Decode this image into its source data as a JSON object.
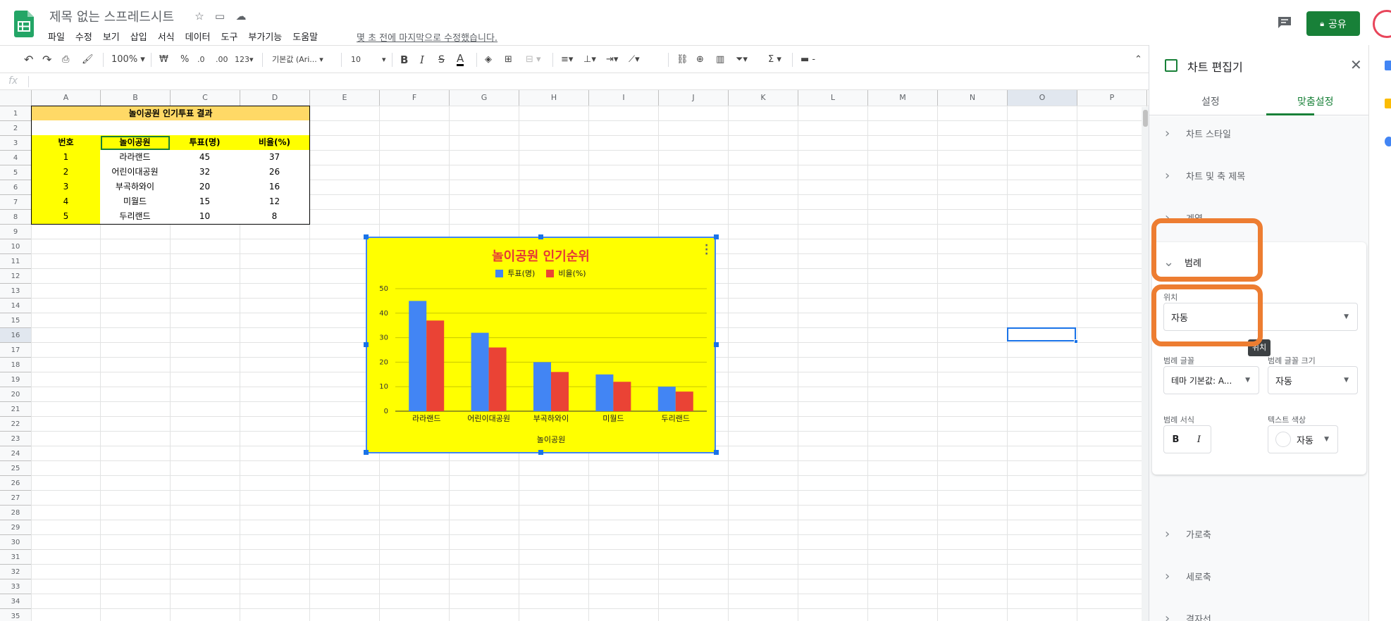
{
  "header": {
    "doc_title": "제목 없는 스프레드시트",
    "menus": [
      "파일",
      "수정",
      "보기",
      "삽입",
      "서식",
      "데이터",
      "도구",
      "부가기능",
      "도움말"
    ],
    "last_edit": "몇 초 전에 마지막으로 수정했습니다.",
    "share_label": "공유"
  },
  "toolbar": {
    "zoom": "100%",
    "currency": "₩",
    "percent": "%",
    "dec_decrease": ".0",
    "dec_increase": ".00",
    "format_more": "123",
    "font": "기본값 (Ari...",
    "font_size": "10",
    "bold": "B",
    "italic": "I",
    "strike": "S",
    "text_color": "A",
    "sum": "Σ"
  },
  "formula_bar": {
    "fx": "fx"
  },
  "grid": {
    "columns": [
      "A",
      "B",
      "C",
      "D",
      "E",
      "F",
      "G",
      "H",
      "I",
      "J",
      "K",
      "L",
      "M",
      "N",
      "O",
      "P"
    ],
    "rows": [
      "1",
      "2",
      "3",
      "4",
      "5",
      "6",
      "7",
      "8",
      "9",
      "10",
      "11",
      "12",
      "13",
      "14",
      "15",
      "16",
      "17",
      "18",
      "19",
      "20",
      "21",
      "22",
      "23",
      "24",
      "25",
      "26",
      "27",
      "28",
      "29",
      "30",
      "31",
      "32",
      "33",
      "34",
      "35"
    ]
  },
  "table": {
    "title": "놀이공원 인기투표 결과",
    "headers": [
      "번호",
      "놀이공원",
      "투표(명)",
      "비율(%)"
    ],
    "rows": [
      [
        "1",
        "라라랜드",
        "45",
        "37"
      ],
      [
        "2",
        "어린이대공원",
        "32",
        "26"
      ],
      [
        "3",
        "부곡하와이",
        "20",
        "16"
      ],
      [
        "4",
        "미월드",
        "15",
        "12"
      ],
      [
        "5",
        "두리랜드",
        "10",
        "8"
      ]
    ]
  },
  "chart_data": {
    "type": "bar",
    "title": "놀이공원 인기순위",
    "xlabel": "놀이공원",
    "ylabel": "",
    "categories": [
      "라라랜드",
      "어린이대공원",
      "부곡하와이",
      "미월드",
      "두리랜드"
    ],
    "series": [
      {
        "name": "투표(명)",
        "values": [
          45,
          32,
          20,
          15,
          10
        ],
        "color": "#4285f4"
      },
      {
        "name": "비율(%)",
        "values": [
          37,
          26,
          16,
          12,
          8
        ],
        "color": "#ea4335"
      }
    ],
    "ylim": [
      0,
      50
    ],
    "yticks": [
      "0",
      "10",
      "20",
      "30",
      "40",
      "50"
    ],
    "legend_position": "top",
    "grid": true,
    "background": "#ffff00",
    "title_color": "#e53935"
  },
  "side_panel": {
    "title": "차트 편집기",
    "tabs": [
      "설정",
      "맞춤설정"
    ],
    "sections_top": [
      "차트 스타일",
      "차트 및 축 제목",
      "계열"
    ],
    "legend_section": {
      "title": "범례",
      "position_label": "위치",
      "position_value": "자동",
      "tooltip": "위치",
      "font_label": "범례 글꼴",
      "font_value": "테마 기본값: A...",
      "font_size_label": "범례 글꼴 크기",
      "font_size_value": "자동",
      "format_label": "범례 서식",
      "text_color_label": "텍스트 색상",
      "text_color_value": "자동",
      "bold": "B",
      "italic": "I"
    },
    "sections_bottom": [
      "가로축",
      "세로축",
      "격자선"
    ]
  },
  "colors": {
    "accent": "#188038",
    "highlight": "#ed7d31",
    "selection": "#1a73e8"
  }
}
